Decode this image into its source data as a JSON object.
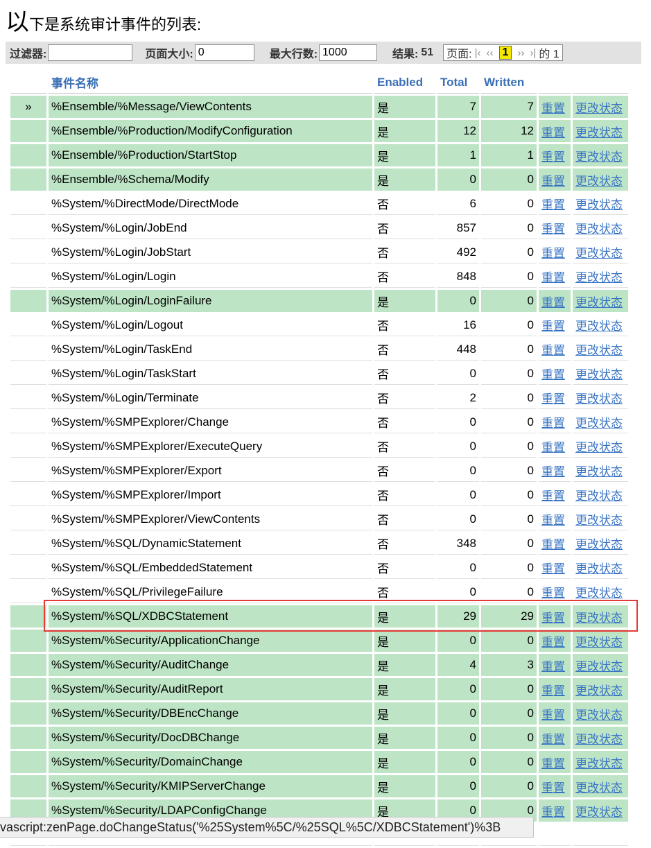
{
  "intro": {
    "first": "以",
    "rest": "下是系统审计事件的列表:"
  },
  "toolbar": {
    "filter_label": "过滤器:",
    "filter_value": "",
    "page_size_label": "页面大小:",
    "page_size_value": "0",
    "max_rows_label": "最大行数:",
    "max_rows_value": "1000",
    "results_label": "结果:",
    "results_value": "51",
    "page_label": "页面:",
    "current_page": "1",
    "of_label": "的 1",
    "first_icon": "|‹",
    "prev_icon": "‹‹",
    "next_icon": "››",
    "last_icon": "›|"
  },
  "table": {
    "headers": [
      "",
      "事件名称",
      "Enabled",
      "Total",
      "Written",
      "",
      ""
    ],
    "reset_label": "重置",
    "change_label": "更改状态",
    "selected_marker": "»",
    "rows": [
      {
        "name": "%Ensemble/%Message/ViewContents",
        "enabled": "是",
        "total": "7",
        "written": "7"
      },
      {
        "name": "%Ensemble/%Production/ModifyConfiguration",
        "enabled": "是",
        "total": "12",
        "written": "12"
      },
      {
        "name": "%Ensemble/%Production/StartStop",
        "enabled": "是",
        "total": "1",
        "written": "1"
      },
      {
        "name": "%Ensemble/%Schema/Modify",
        "enabled": "是",
        "total": "0",
        "written": "0"
      },
      {
        "name": "%System/%DirectMode/DirectMode",
        "enabled": "否",
        "total": "6",
        "written": "0"
      },
      {
        "name": "%System/%Login/JobEnd",
        "enabled": "否",
        "total": "857",
        "written": "0"
      },
      {
        "name": "%System/%Login/JobStart",
        "enabled": "否",
        "total": "492",
        "written": "0"
      },
      {
        "name": "%System/%Login/Login",
        "enabled": "否",
        "total": "848",
        "written": "0"
      },
      {
        "name": "%System/%Login/LoginFailure",
        "enabled": "是",
        "total": "0",
        "written": "0"
      },
      {
        "name": "%System/%Login/Logout",
        "enabled": "否",
        "total": "16",
        "written": "0"
      },
      {
        "name": "%System/%Login/TaskEnd",
        "enabled": "否",
        "total": "448",
        "written": "0"
      },
      {
        "name": "%System/%Login/TaskStart",
        "enabled": "否",
        "total": "0",
        "written": "0"
      },
      {
        "name": "%System/%Login/Terminate",
        "enabled": "否",
        "total": "2",
        "written": "0"
      },
      {
        "name": "%System/%SMPExplorer/Change",
        "enabled": "否",
        "total": "0",
        "written": "0"
      },
      {
        "name": "%System/%SMPExplorer/ExecuteQuery",
        "enabled": "否",
        "total": "0",
        "written": "0"
      },
      {
        "name": "%System/%SMPExplorer/Export",
        "enabled": "否",
        "total": "0",
        "written": "0"
      },
      {
        "name": "%System/%SMPExplorer/Import",
        "enabled": "否",
        "total": "0",
        "written": "0"
      },
      {
        "name": "%System/%SMPExplorer/ViewContents",
        "enabled": "否",
        "total": "0",
        "written": "0"
      },
      {
        "name": "%System/%SQL/DynamicStatement",
        "enabled": "否",
        "total": "348",
        "written": "0"
      },
      {
        "name": "%System/%SQL/EmbeddedStatement",
        "enabled": "否",
        "total": "0",
        "written": "0"
      },
      {
        "name": "%System/%SQL/PrivilegeFailure",
        "enabled": "否",
        "total": "0",
        "written": "0"
      },
      {
        "name": "%System/%SQL/XDBCStatement",
        "enabled": "是",
        "total": "29",
        "written": "29"
      },
      {
        "name": "%System/%Security/ApplicationChange",
        "enabled": "是",
        "total": "0",
        "written": "0"
      },
      {
        "name": "%System/%Security/AuditChange",
        "enabled": "是",
        "total": "4",
        "written": "3"
      },
      {
        "name": "%System/%Security/AuditReport",
        "enabled": "是",
        "total": "0",
        "written": "0"
      },
      {
        "name": "%System/%Security/DBEncChange",
        "enabled": "是",
        "total": "0",
        "written": "0"
      },
      {
        "name": "%System/%Security/DocDBChange",
        "enabled": "是",
        "total": "0",
        "written": "0"
      },
      {
        "name": "%System/%Security/DomainChange",
        "enabled": "是",
        "total": "0",
        "written": "0"
      },
      {
        "name": "%System/%Security/KMIPServerChange",
        "enabled": "是",
        "total": "0",
        "written": "0"
      },
      {
        "name": "%System/%Security/LDAPConfigChange",
        "enabled": "是",
        "total": "0",
        "written": "0"
      },
      {
        "name": "",
        "enabled": "",
        "total": "",
        "written": ""
      }
    ]
  },
  "status_bar": "vascript:zenPage.doChangeStatus('%25System%5C/%25SQL%5C/XDBCStatement')%3B"
}
